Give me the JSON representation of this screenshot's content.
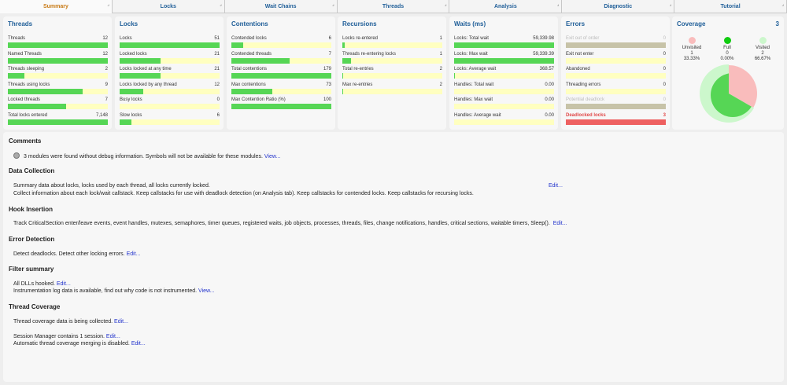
{
  "tabs": [
    {
      "label": "Summary",
      "active": true
    },
    {
      "label": "Locks"
    },
    {
      "label": "Wait Chains"
    },
    {
      "label": "Threads"
    },
    {
      "label": "Analysis"
    },
    {
      "label": "Diagnostic"
    },
    {
      "label": "Tutorial"
    }
  ],
  "colors": {
    "accent": "#1f5e98",
    "active_tab": "#c87a15",
    "bar_fill": "#56d655",
    "bar_track": "#ffffc0",
    "bar_disabled": "#c7c3a8",
    "bar_error": "#ee6060",
    "error_text": "#e04848"
  },
  "panels": {
    "threads": {
      "title": "Threads",
      "rows": [
        {
          "label": "Threads",
          "value": "12",
          "fill": 1.0
        },
        {
          "label": "Named Threads",
          "value": "12",
          "fill": 1.0
        },
        {
          "label": "Threads sleeping",
          "value": "2",
          "fill": 0.167
        },
        {
          "label": "Threads using locks",
          "value": "9",
          "fill": 0.75
        },
        {
          "label": "Locked threads",
          "value": "7",
          "fill": 0.58
        },
        {
          "label": "Total locks entered",
          "value": "7,148",
          "fill": 1.0
        }
      ]
    },
    "locks": {
      "title": "Locks",
      "rows": [
        {
          "label": "Locks",
          "value": "51",
          "fill": 1.0
        },
        {
          "label": "Locked locks",
          "value": "21",
          "fill": 0.41
        },
        {
          "label": "Locks locked at any time",
          "value": "21",
          "fill": 0.41
        },
        {
          "label": "Locks locked by any thread",
          "value": "12",
          "fill": 0.235
        },
        {
          "label": "Busy locks",
          "value": "0",
          "fill": 0
        },
        {
          "label": "Slow locks",
          "value": "6",
          "fill": 0.118
        }
      ]
    },
    "contentions": {
      "title": "Contentions",
      "rows": [
        {
          "label": "Contended locks",
          "value": "6",
          "fill": 0.118
        },
        {
          "label": "Contended threads",
          "value": "7",
          "fill": 0.58
        },
        {
          "label": "Total contentions",
          "value": "179",
          "fill": 1.0
        },
        {
          "label": "Max contentions",
          "value": "73",
          "fill": 0.41
        },
        {
          "label": "Max Contention Ratio (%)",
          "value": "100",
          "fill": 1.0
        }
      ]
    },
    "recursions": {
      "title": "Recursions",
      "rows": [
        {
          "label": "Locks re-entered",
          "value": "1",
          "fill": 0.02
        },
        {
          "label": "Threads re-entering locks",
          "value": "1",
          "fill": 0.083
        },
        {
          "label": "Total re-entries",
          "value": "2",
          "fill": 0.011
        },
        {
          "label": "Max re-entries",
          "value": "2",
          "fill": 0.011
        }
      ]
    },
    "waits": {
      "title": "Waits (ms)",
      "rows": [
        {
          "label": "Locks: Total wait",
          "value": "59,339.98",
          "fill": 1.0
        },
        {
          "label": "Locks: Max wait",
          "value": "59,339.39",
          "fill": 1.0
        },
        {
          "label": "Locks: Average wait",
          "value": "368.57",
          "fill": 0.006
        },
        {
          "label": "Handles: Total wait",
          "value": "0.00",
          "fill": 0
        },
        {
          "label": "Handles: Max wait",
          "value": "0.00",
          "fill": 0
        },
        {
          "label": "Handles: Average wait",
          "value": "0.00",
          "fill": 0
        }
      ]
    },
    "errors": {
      "title": "Errors",
      "rows": [
        {
          "label": "Exit out of order",
          "value": "0",
          "fill": 0,
          "state": "gray"
        },
        {
          "label": "Exit not enter",
          "value": "0",
          "fill": 0
        },
        {
          "label": "Abandoned",
          "value": "0",
          "fill": 0
        },
        {
          "label": "Threading errors",
          "value": "0",
          "fill": 0
        },
        {
          "label": "Potential deadlock",
          "value": "0",
          "fill": 0,
          "state": "gray"
        },
        {
          "label": "Deadlocked locks",
          "value": "3",
          "fill": 0,
          "state": "red"
        }
      ]
    }
  },
  "coverage": {
    "title": "Coverage",
    "count": "3",
    "legend": [
      {
        "label": "Unvisited",
        "count": "1",
        "percent": "33.33%",
        "color": "#f9bcbc",
        "value": 33.33
      },
      {
        "label": "Full",
        "count": "0",
        "percent": "0.00%",
        "color": "#11cc11",
        "value": 0
      },
      {
        "label": "Visited",
        "count": "2",
        "percent": "66.67%",
        "color": "#ccf7cc",
        "value": 66.67
      }
    ]
  },
  "content": {
    "comments": {
      "title": "Comments",
      "text": "3 modules were found without debug information. Symbols will not be available for these modules.",
      "link": "View..."
    },
    "data_collection": {
      "title": "Data Collection",
      "line1": "Summary data about locks, locks used by each thread, all locks currently locked.",
      "line1_link": "Edit...",
      "line2": "Collect information about each lock/wait callstack. Keep callstacks for use with deadlock detection (on Analysis tab). Keep callstacks for contended locks. Keep callstacks for recursing locks."
    },
    "hook_insertion": {
      "title": "Hook Insertion",
      "text": "Track CriticalSection enter/leave events, event handles, mutexes, semaphores, timer queues, registered waits, job objects, processes, threads, files, change notifications, handles, critical sections, waitable timers, Sleep().",
      "link": "Edit..."
    },
    "error_detection": {
      "title": "Error Detection",
      "text": "Detect deadlocks. Detect other locking errors.",
      "link": "Edit..."
    },
    "filter_summary": {
      "title": "Filter summary",
      "line1": "All DLLs hooked.",
      "line1_link": "Edit...",
      "line2": "Instrumentation log data is available, find out why code is not instrumented.",
      "line2_link": "View..."
    },
    "thread_coverage": {
      "title": "Thread Coverage",
      "line1": "Thread coverage data is being collected.",
      "line1_link": "Edit...",
      "line2": "Session Manager contains 1 session.",
      "line2_link": "Edit...",
      "line3": "Automatic thread coverage merging is disabled.",
      "line3_link": "Edit..."
    }
  }
}
